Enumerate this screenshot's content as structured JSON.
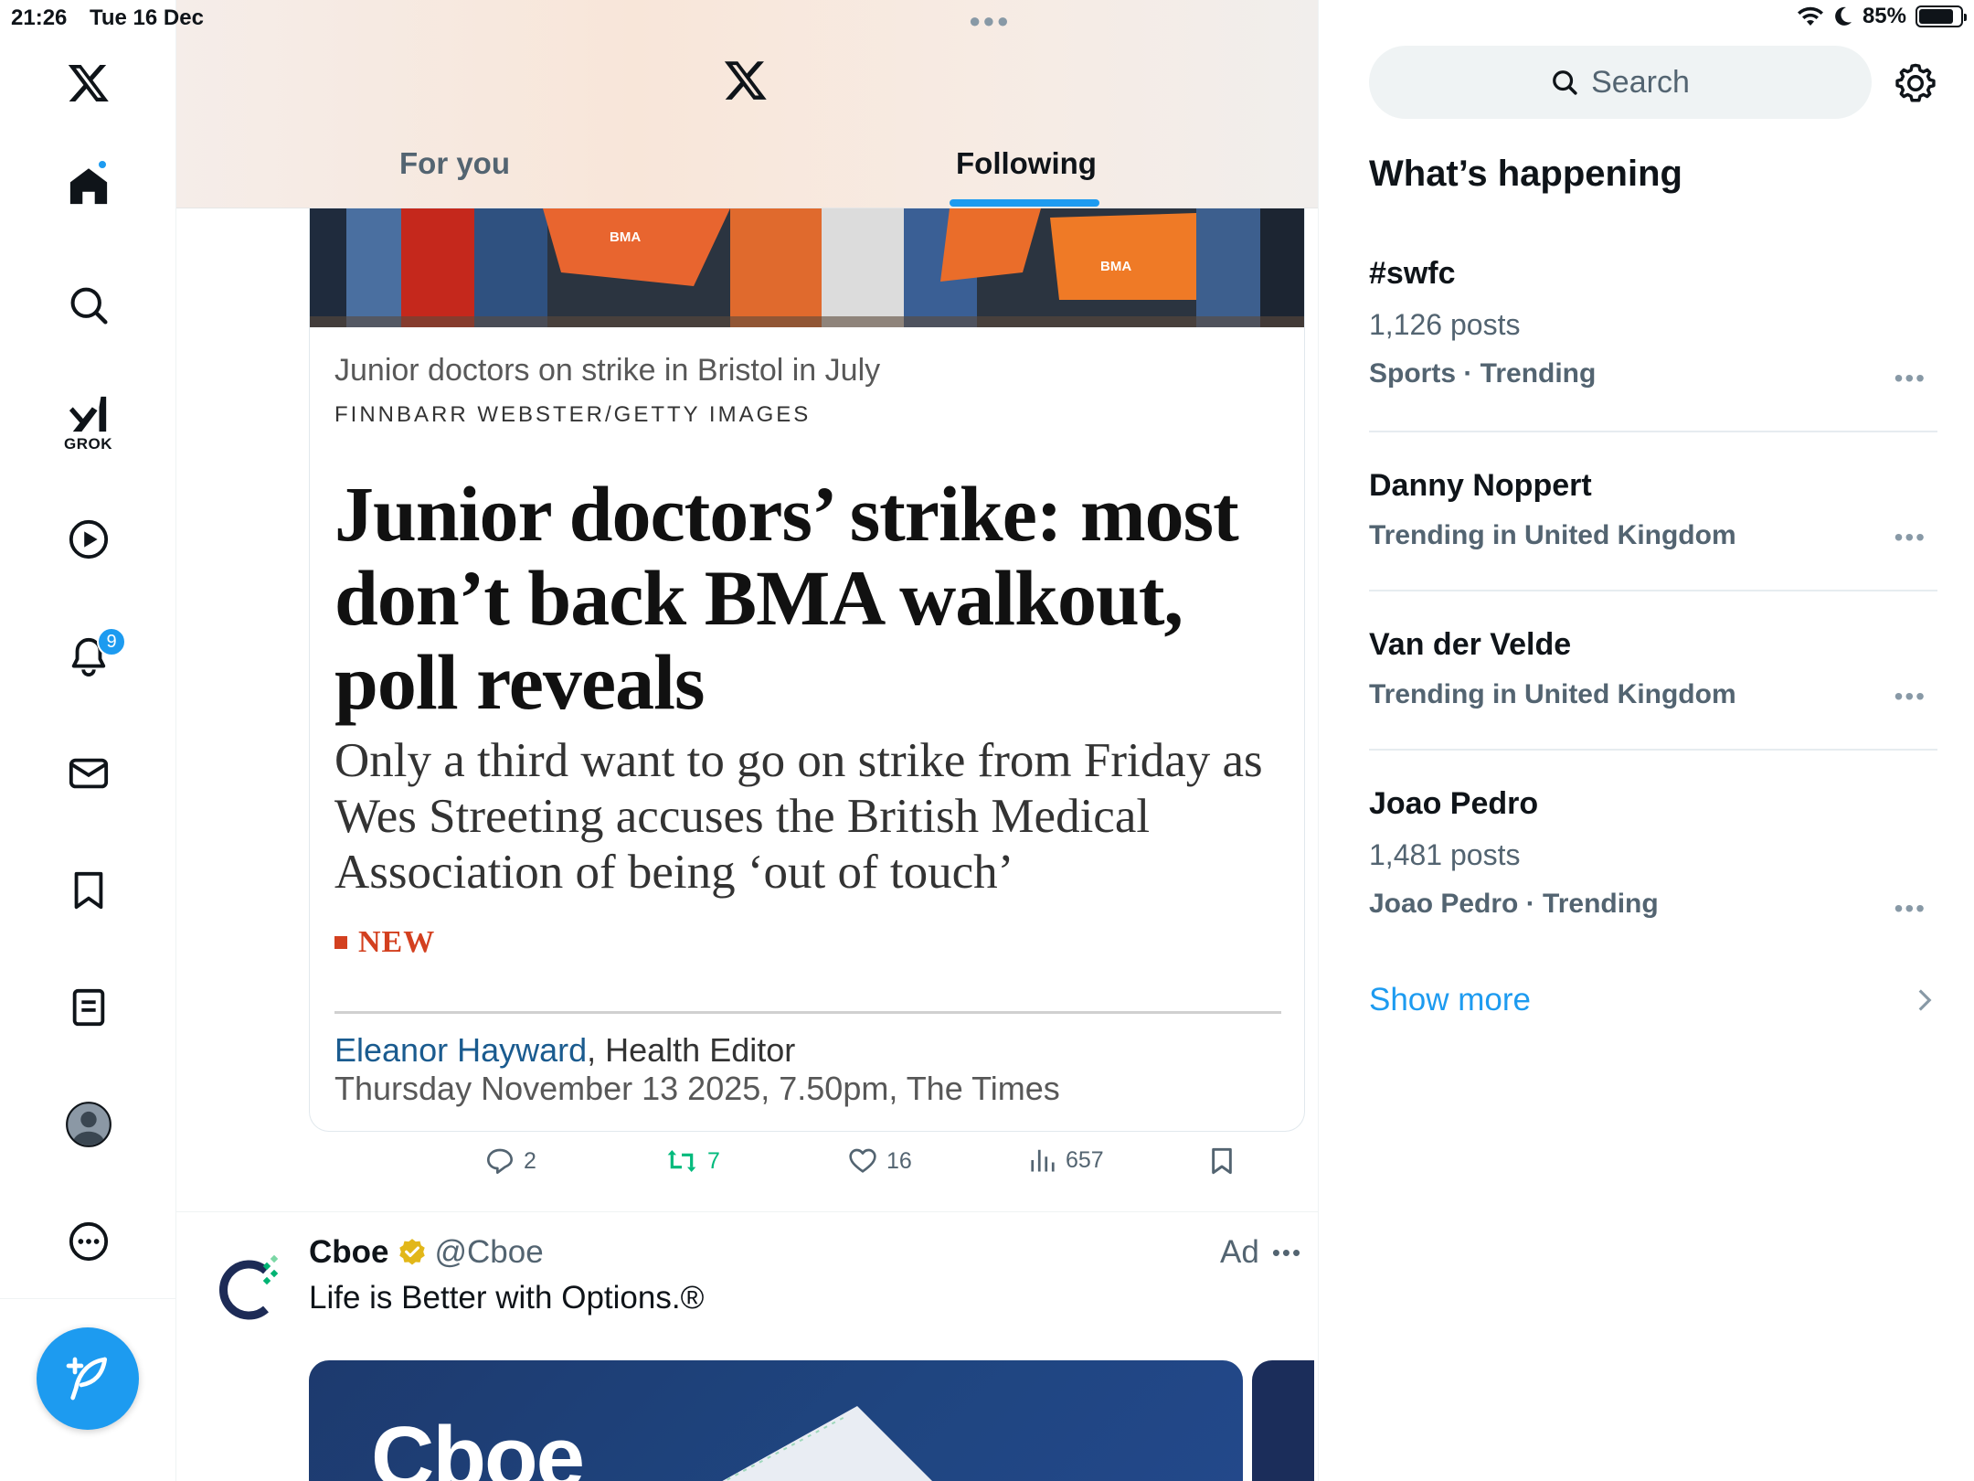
{
  "status": {
    "time": "21:26",
    "date": "Tue 16 Dec",
    "battery": "85%",
    "battery_level": 0.85
  },
  "nav": {
    "grok_label": "GROK",
    "notifications_count": "9",
    "icons": [
      "x-logo",
      "home-icon",
      "search-icon",
      "grok-icon",
      "video-icon",
      "bell-icon",
      "mail-icon",
      "bookmark-icon",
      "lists-icon",
      "profile-icon",
      "more-icon",
      "compose-icon"
    ]
  },
  "header": {
    "tabs": [
      {
        "label": "For you",
        "active": false
      },
      {
        "label": "Following",
        "active": true
      }
    ]
  },
  "article": {
    "caption": "Junior doctors on strike in Bristol in July",
    "credit": "FINNBARR WEBSTER/GETTY IMAGES",
    "headline": "Junior doctors’ strike: most don’t back BMA walkout, poll reveals",
    "standfirst": "Only a third want to go on strike from Friday as Wes Streeting accuses the British Medical Association of being ‘out of touch’",
    "new_label": "NEW",
    "author": "Eleanor Hayward",
    "author_role": ", Health Editor",
    "dateline": "Thursday November 13 2025, 7.50pm, The Times",
    "photo_placards": [
      "BMA",
      "BMA",
      "BMA"
    ]
  },
  "actions": {
    "replies": "2",
    "reposts": "7",
    "likes": "16",
    "views": "657"
  },
  "ad": {
    "name": "Cboe",
    "handle": "@Cboe",
    "label": "Ad",
    "text": "Life is Better with Options.®",
    "media_logo": "Cboe"
  },
  "sidebar": {
    "search_placeholder": "Search",
    "heading": "What’s happening",
    "trends": [
      {
        "title": "#swfc",
        "posts": "1,126 posts",
        "meta": "Sports · Trending"
      },
      {
        "title": "Danny Noppert",
        "posts": "",
        "meta": "Trending in United Kingdom"
      },
      {
        "title": "Van der Velde",
        "posts": "",
        "meta": "Trending in United Kingdom"
      },
      {
        "title": "Joao Pedro",
        "posts": "1,481 posts",
        "meta": "Joao Pedro · Trending"
      }
    ],
    "show_more": "Show more"
  },
  "colors": {
    "accent": "#1d9bf0",
    "repost_green": "#00ba7c",
    "times_red": "#d3401f",
    "muted": "#536471"
  }
}
